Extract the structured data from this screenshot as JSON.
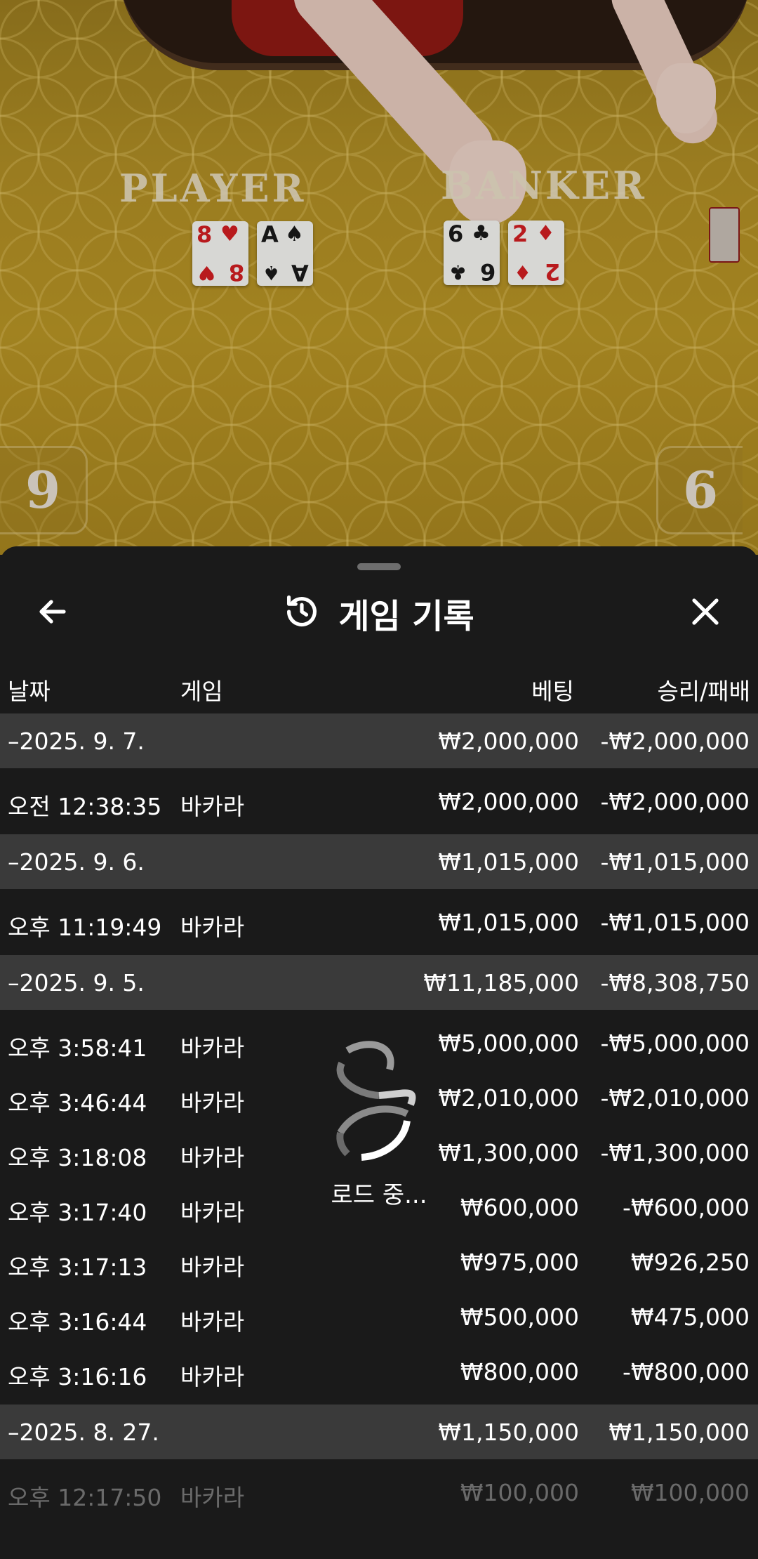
{
  "video": {
    "player_label": "PLAYER",
    "banker_label": "BANKER",
    "player_score": "9",
    "banker_score": "6",
    "player_cards": [
      {
        "rank": "8",
        "suit": "♥",
        "color": "red"
      },
      {
        "rank": "A",
        "suit": "♠",
        "color": "black"
      }
    ],
    "banker_cards": [
      {
        "rank": "6",
        "suit": "♣",
        "color": "black"
      },
      {
        "rank": "2",
        "suit": "♦",
        "color": "red"
      }
    ]
  },
  "header": {
    "title": "게임 기록",
    "back_icon": "arrow-left-icon",
    "history_icon": "history-clock-icon",
    "close_icon": "close-x-icon"
  },
  "columns": {
    "date": "날짜",
    "game": "게임",
    "bet": "베팅",
    "winloss": "승리/패배"
  },
  "rows": [
    {
      "type": "group",
      "date": "–2025. 9. 7.",
      "game": "",
      "bet": "₩2,000,000",
      "winloss": "-₩2,000,000"
    },
    {
      "type": "item",
      "date": "오전 12:38:35",
      "game": "바카라",
      "bet": "₩2,000,000",
      "winloss": "-₩2,000,000"
    },
    {
      "type": "group",
      "date": "–2025. 9. 6.",
      "game": "",
      "bet": "₩1,015,000",
      "winloss": "-₩1,015,000"
    },
    {
      "type": "item",
      "date": "오후 11:19:49",
      "game": "바카라",
      "bet": "₩1,015,000",
      "winloss": "-₩1,015,000"
    },
    {
      "type": "group",
      "date": "–2025. 9. 5.",
      "game": "",
      "bet": "₩11,185,000",
      "winloss": "-₩8,308,750"
    },
    {
      "type": "item",
      "date": "오후 3:58:41",
      "game": "바카라",
      "bet": "₩5,000,000",
      "winloss": "-₩5,000,000"
    },
    {
      "type": "item",
      "date": "오후 3:46:44",
      "game": "바카라",
      "bet": "₩2,010,000",
      "winloss": "-₩2,010,000"
    },
    {
      "type": "item",
      "date": "오후 3:18:08",
      "game": "바카라",
      "bet": "₩1,300,000",
      "winloss": "-₩1,300,000"
    },
    {
      "type": "item",
      "date": "오후 3:17:40",
      "game": "바카라",
      "bet": "₩600,000",
      "winloss": "-₩600,000"
    },
    {
      "type": "item",
      "date": "오후 3:17:13",
      "game": "바카라",
      "bet": "₩975,000",
      "winloss": "₩926,250"
    },
    {
      "type": "item",
      "date": "오후 3:16:44",
      "game": "바카라",
      "bet": "₩500,000",
      "winloss": "₩475,000"
    },
    {
      "type": "item",
      "date": "오후 3:16:16",
      "game": "바카라",
      "bet": "₩800,000",
      "winloss": "-₩800,000"
    },
    {
      "type": "group",
      "date": "–2025. 8. 27.",
      "game": "",
      "bet": "₩1,150,000",
      "winloss": "₩1,150,000"
    },
    {
      "type": "item",
      "date": "오후 12:17:50",
      "game": "바카라",
      "bet": "₩100,000",
      "winloss": "₩100,000",
      "faded": true
    }
  ],
  "loading": {
    "label": "로드 중...",
    "icon": "loading-spinner-icon"
  }
}
